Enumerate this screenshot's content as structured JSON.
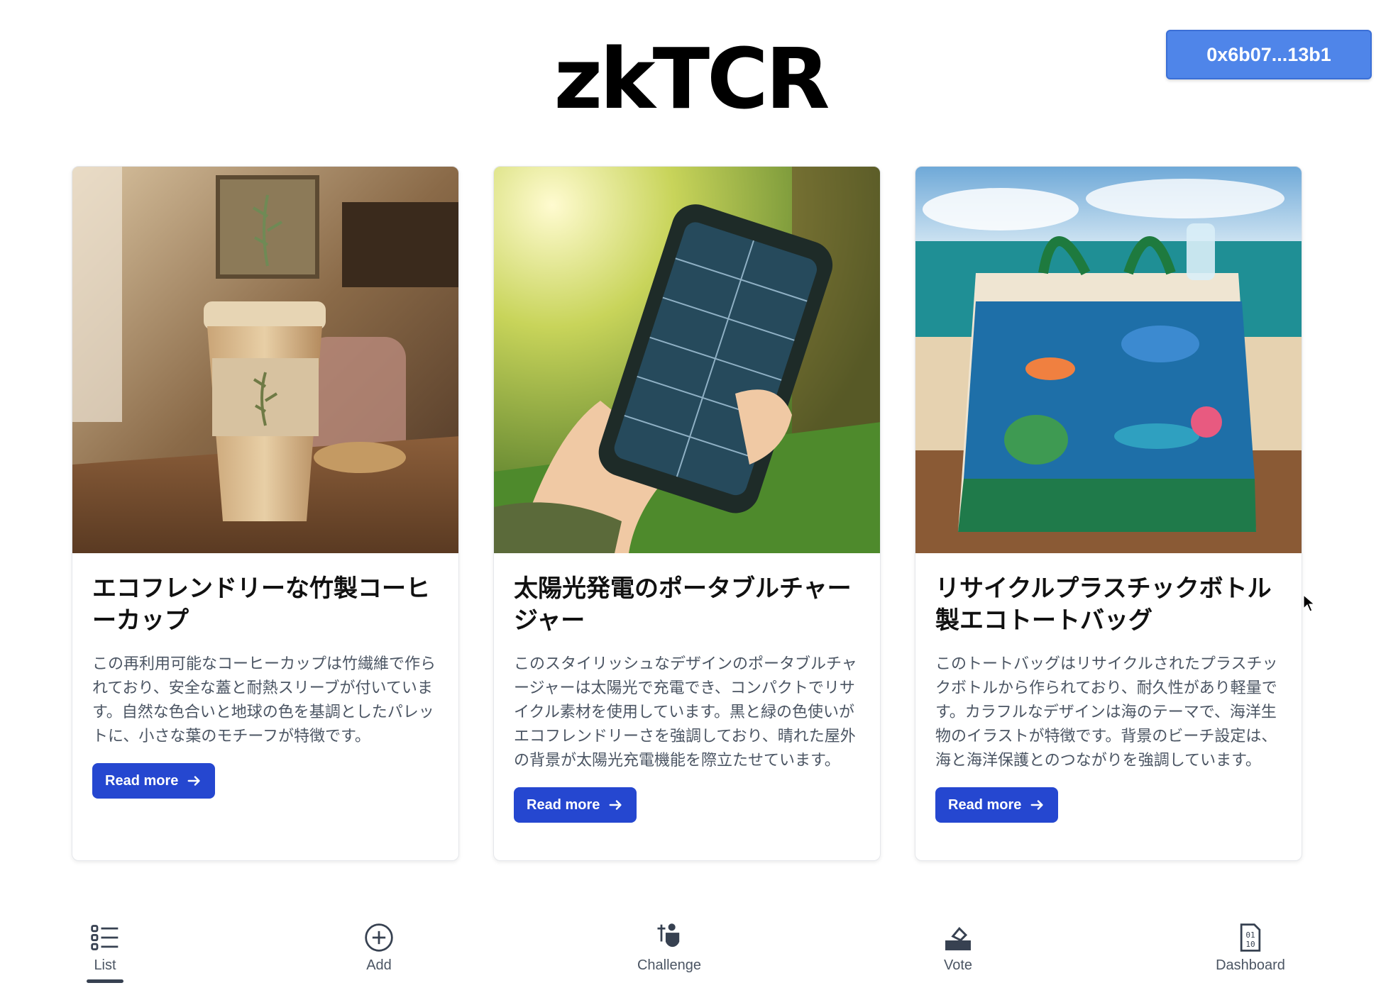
{
  "header": {
    "logo": "zkTCR",
    "wallet_address": "0x6b07...13b1"
  },
  "cards": [
    {
      "title": "エコフレンドリーな竹製コーヒーカップ",
      "description": "この再利用可能なコーヒーカップは竹繊維で作られており、安全な蓋と耐熱スリーブが付いています。自然な色合いと地球の色を基調としたパレットに、小さな葉のモチーフが特徴です。",
      "button_label": "Read more"
    },
    {
      "title": "太陽光発電のポータブルチャージャー",
      "description": "このスタイリッシュなデザインのポータブルチャージャーは太陽光で充電でき、コンパクトでリサイクル素材を使用しています。黒と緑の色使いがエコフレンドリーさを強調しており、晴れた屋外の背景が太陽光充電機能を際立たせています。",
      "button_label": "Read more"
    },
    {
      "title": "リサイクルプラスチックボトル製エコトートバッグ",
      "description": "このトートバッグはリサイクルされたプラスチックボトルから作られており、耐久性があり軽量です。カラフルなデザインは海のテーマで、海洋生物のイラストが特徴です。背景のビーチ設定は、海と海洋保護とのつながりを強調しています。",
      "button_label": "Read more"
    }
  ],
  "nav": {
    "items": [
      {
        "label": "List",
        "icon": "list-icon",
        "active": true
      },
      {
        "label": "Add",
        "icon": "plus-circle-icon",
        "active": false
      },
      {
        "label": "Challenge",
        "icon": "challenge-icon",
        "active": false
      },
      {
        "label": "Vote",
        "icon": "vote-icon",
        "active": false
      },
      {
        "label": "Dashboard",
        "icon": "binary-file-icon",
        "active": false
      }
    ]
  },
  "colors": {
    "wallet_button": "#4f85e9",
    "read_more_button": "#2547d0",
    "active_indicator": "#374151"
  }
}
